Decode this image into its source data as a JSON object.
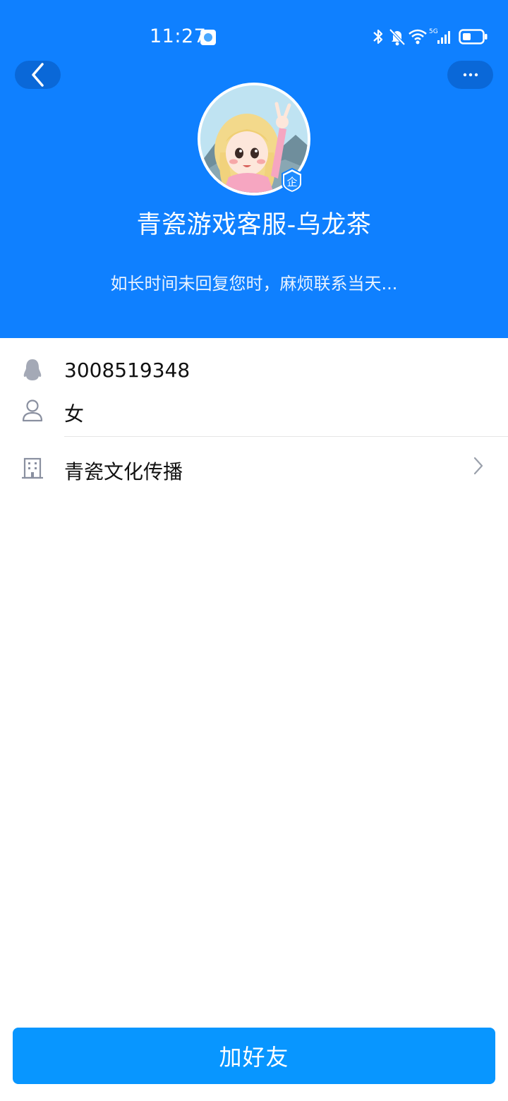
{
  "status_bar": {
    "time": "11:27",
    "icons": [
      "bluetooth-icon",
      "mute-bell-icon",
      "wifi-icon",
      "signal-5g-icon",
      "battery-icon"
    ],
    "network": "5G"
  },
  "header": {
    "background_color": "#0f80ff",
    "back_icon": "chevron-left-icon",
    "more_icon": "more-dots-icon"
  },
  "profile": {
    "avatar_icon": "avatar-image",
    "badge_label": "企",
    "name": "青瓷游戏客服-乌龙茶",
    "signature": "如长时间未回复您时，麻烦联系当天..."
  },
  "info": {
    "qq_number": "3008519348",
    "gender": "女",
    "company": "青瓷文化传播"
  },
  "footer": {
    "add_friend_label": "加好友",
    "button_color": "#0896ff"
  }
}
